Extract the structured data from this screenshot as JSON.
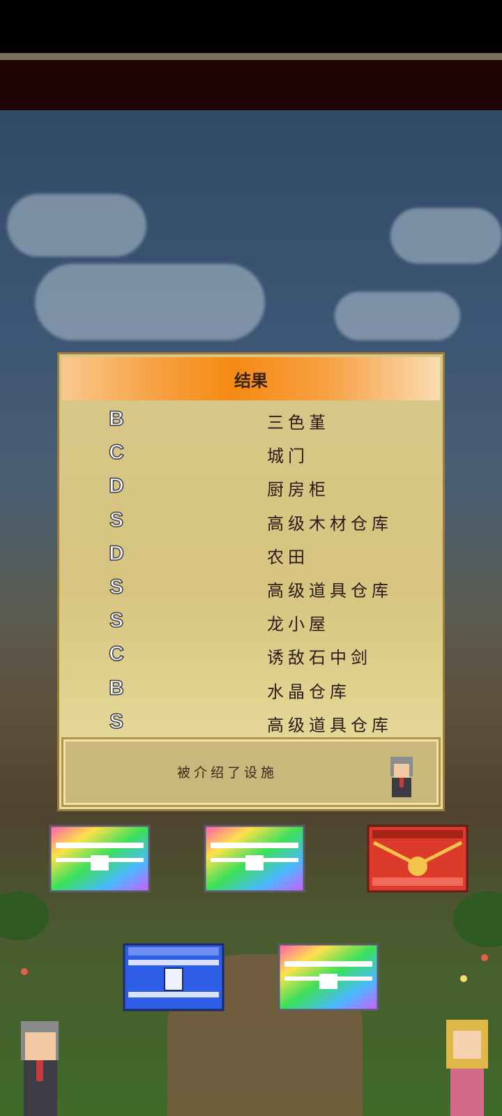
{
  "dialog": {
    "title": "结果",
    "rows": [
      {
        "grade": "B",
        "item": "三色堇"
      },
      {
        "grade": "C",
        "item": "城门"
      },
      {
        "grade": "D",
        "item": "厨房柜"
      },
      {
        "grade": "S",
        "item": "高级木材仓库"
      },
      {
        "grade": "D",
        "item": "农田"
      },
      {
        "grade": "S",
        "item": "高级道具仓库"
      },
      {
        "grade": "S",
        "item": "龙小屋"
      },
      {
        "grade": "C",
        "item": "诱敌石中剑"
      },
      {
        "grade": "B",
        "item": "水晶仓库"
      },
      {
        "grade": "S",
        "item": "高级道具仓库"
      }
    ],
    "footer_text": "被介绍了设施"
  },
  "chests": [
    {
      "type": "rainbow",
      "icon": "rainbow-chest-icon"
    },
    {
      "type": "rainbow",
      "icon": "rainbow-chest-icon"
    },
    {
      "type": "red",
      "icon": "red-chest-icon"
    },
    {
      "type": "blue",
      "icon": "blue-chest-icon"
    },
    {
      "type": "rainbow",
      "icon": "rainbow-chest-icon"
    }
  ],
  "colors": {
    "header_orange": "#f58a12",
    "dialog_bg": "#d6c47f",
    "top_bar": "#1f0505"
  }
}
